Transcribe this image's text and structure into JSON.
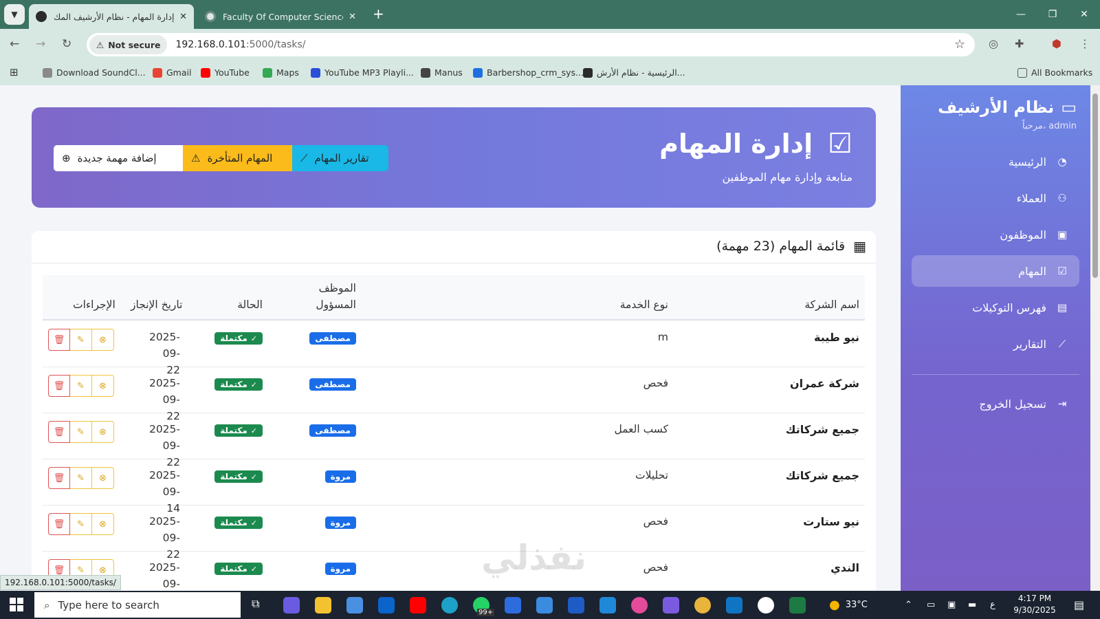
{
  "browser": {
    "tabs": [
      {
        "title": "إدارة المهام - نظام الأرشيف المك...",
        "active": true
      },
      {
        "title": "Faculty Of Computer Science an",
        "active": false
      }
    ],
    "new_tab": "+",
    "not_secure": "Not secure",
    "url_host": "192.168.0.101",
    "url_path": ":5000/tasks/",
    "bookmarks": [
      {
        "label": "Download SoundCl...",
        "color": "#8a8a8a"
      },
      {
        "label": "Gmail",
        "color": "#ea4335"
      },
      {
        "label": "YouTube",
        "color": "#ff0000"
      },
      {
        "label": "Maps",
        "color": "#34a853"
      },
      {
        "label": "YouTube MP3 Playli...",
        "color": "#2a4fd6"
      },
      {
        "label": "Manus",
        "color": "#444444"
      },
      {
        "label": "Barbershop_crm_sys...",
        "color": "#1e6fe0"
      },
      {
        "label": "الرئيسية - نظام الأرش...",
        "color": "#2b2b2b"
      }
    ],
    "all_bookmarks": "All Bookmarks",
    "status_url": "192.168.0.101:5000/tasks/"
  },
  "sidebar": {
    "brand": "نظام الأرشيف",
    "welcome": "مرحباً، admin",
    "items": [
      {
        "label": "الرئيسية",
        "icon": "◔",
        "active": false
      },
      {
        "label": "العملاء",
        "icon": "⚇",
        "active": false
      },
      {
        "label": "الموظفون",
        "icon": "▣",
        "active": false
      },
      {
        "label": "المهام",
        "icon": "☑",
        "active": true
      },
      {
        "label": "فهرس التوكيلات",
        "icon": "▤",
        "active": false
      },
      {
        "label": "التقارير",
        "icon": "⟋",
        "active": false
      }
    ],
    "logout": "تسجيل الخروج"
  },
  "hero": {
    "title": "إدارة المهام",
    "subtitle": "متابعة وإدارة مهام الموظفين",
    "btn_add": "إضافة مهمة جديدة",
    "btn_late": "المهام المتأخرة",
    "btn_reports": "تقارير المهام"
  },
  "table": {
    "title": "قائمة المهام (23 مهمة)",
    "headers": {
      "company": "اسم الشركة",
      "service": "نوع الخدمة",
      "employee_l1": "الموظف",
      "employee_l2": "المسؤول",
      "status": "الحالة",
      "date": "تاريخ الإنجاز",
      "actions": "الإجراءات"
    },
    "rows": [
      {
        "company": "نيو طيبة",
        "service": "m",
        "employee": "مصطفى",
        "status": "مكتملة",
        "date_l1": "2025-09-",
        "date_l2": "22"
      },
      {
        "company": "شركة عمران",
        "service": "فحص",
        "employee": "مصطفى",
        "status": "مكتملة",
        "date_l1": "2025-09-",
        "date_l2": "22"
      },
      {
        "company": "جميع شركاتك",
        "service": "كسب العمل",
        "employee": "مصطفى",
        "status": "مكتملة",
        "date_l1": "2025-09-",
        "date_l2": "22"
      },
      {
        "company": "جميع شركاتك",
        "service": "تحليلات",
        "employee": "مروة",
        "status": "مكتملة",
        "date_l1": "2025-09-",
        "date_l2": "14"
      },
      {
        "company": "نيو ستارت",
        "service": "فحص",
        "employee": "مروة",
        "status": "مكتملة",
        "date_l1": "2025-09-",
        "date_l2": "22"
      },
      {
        "company": "الندي",
        "service": "فحص",
        "employee": "مروة",
        "status": "مكتملة",
        "date_l1": "2025-09-",
        "date_l2": "14"
      }
    ]
  },
  "watermark": "نفذلي",
  "taskbar": {
    "search_placeholder": "Type here to search",
    "weather": "33°C",
    "time": "4:17 PM",
    "date": "9/30/2025",
    "badge": "99+"
  },
  "colors": {
    "accent_purple": "#7479dc",
    "warning": "#fbbb1b",
    "info": "#19b8e6",
    "success": "#1c8a4f",
    "primary": "#1a6de8",
    "danger": "#e05252"
  }
}
